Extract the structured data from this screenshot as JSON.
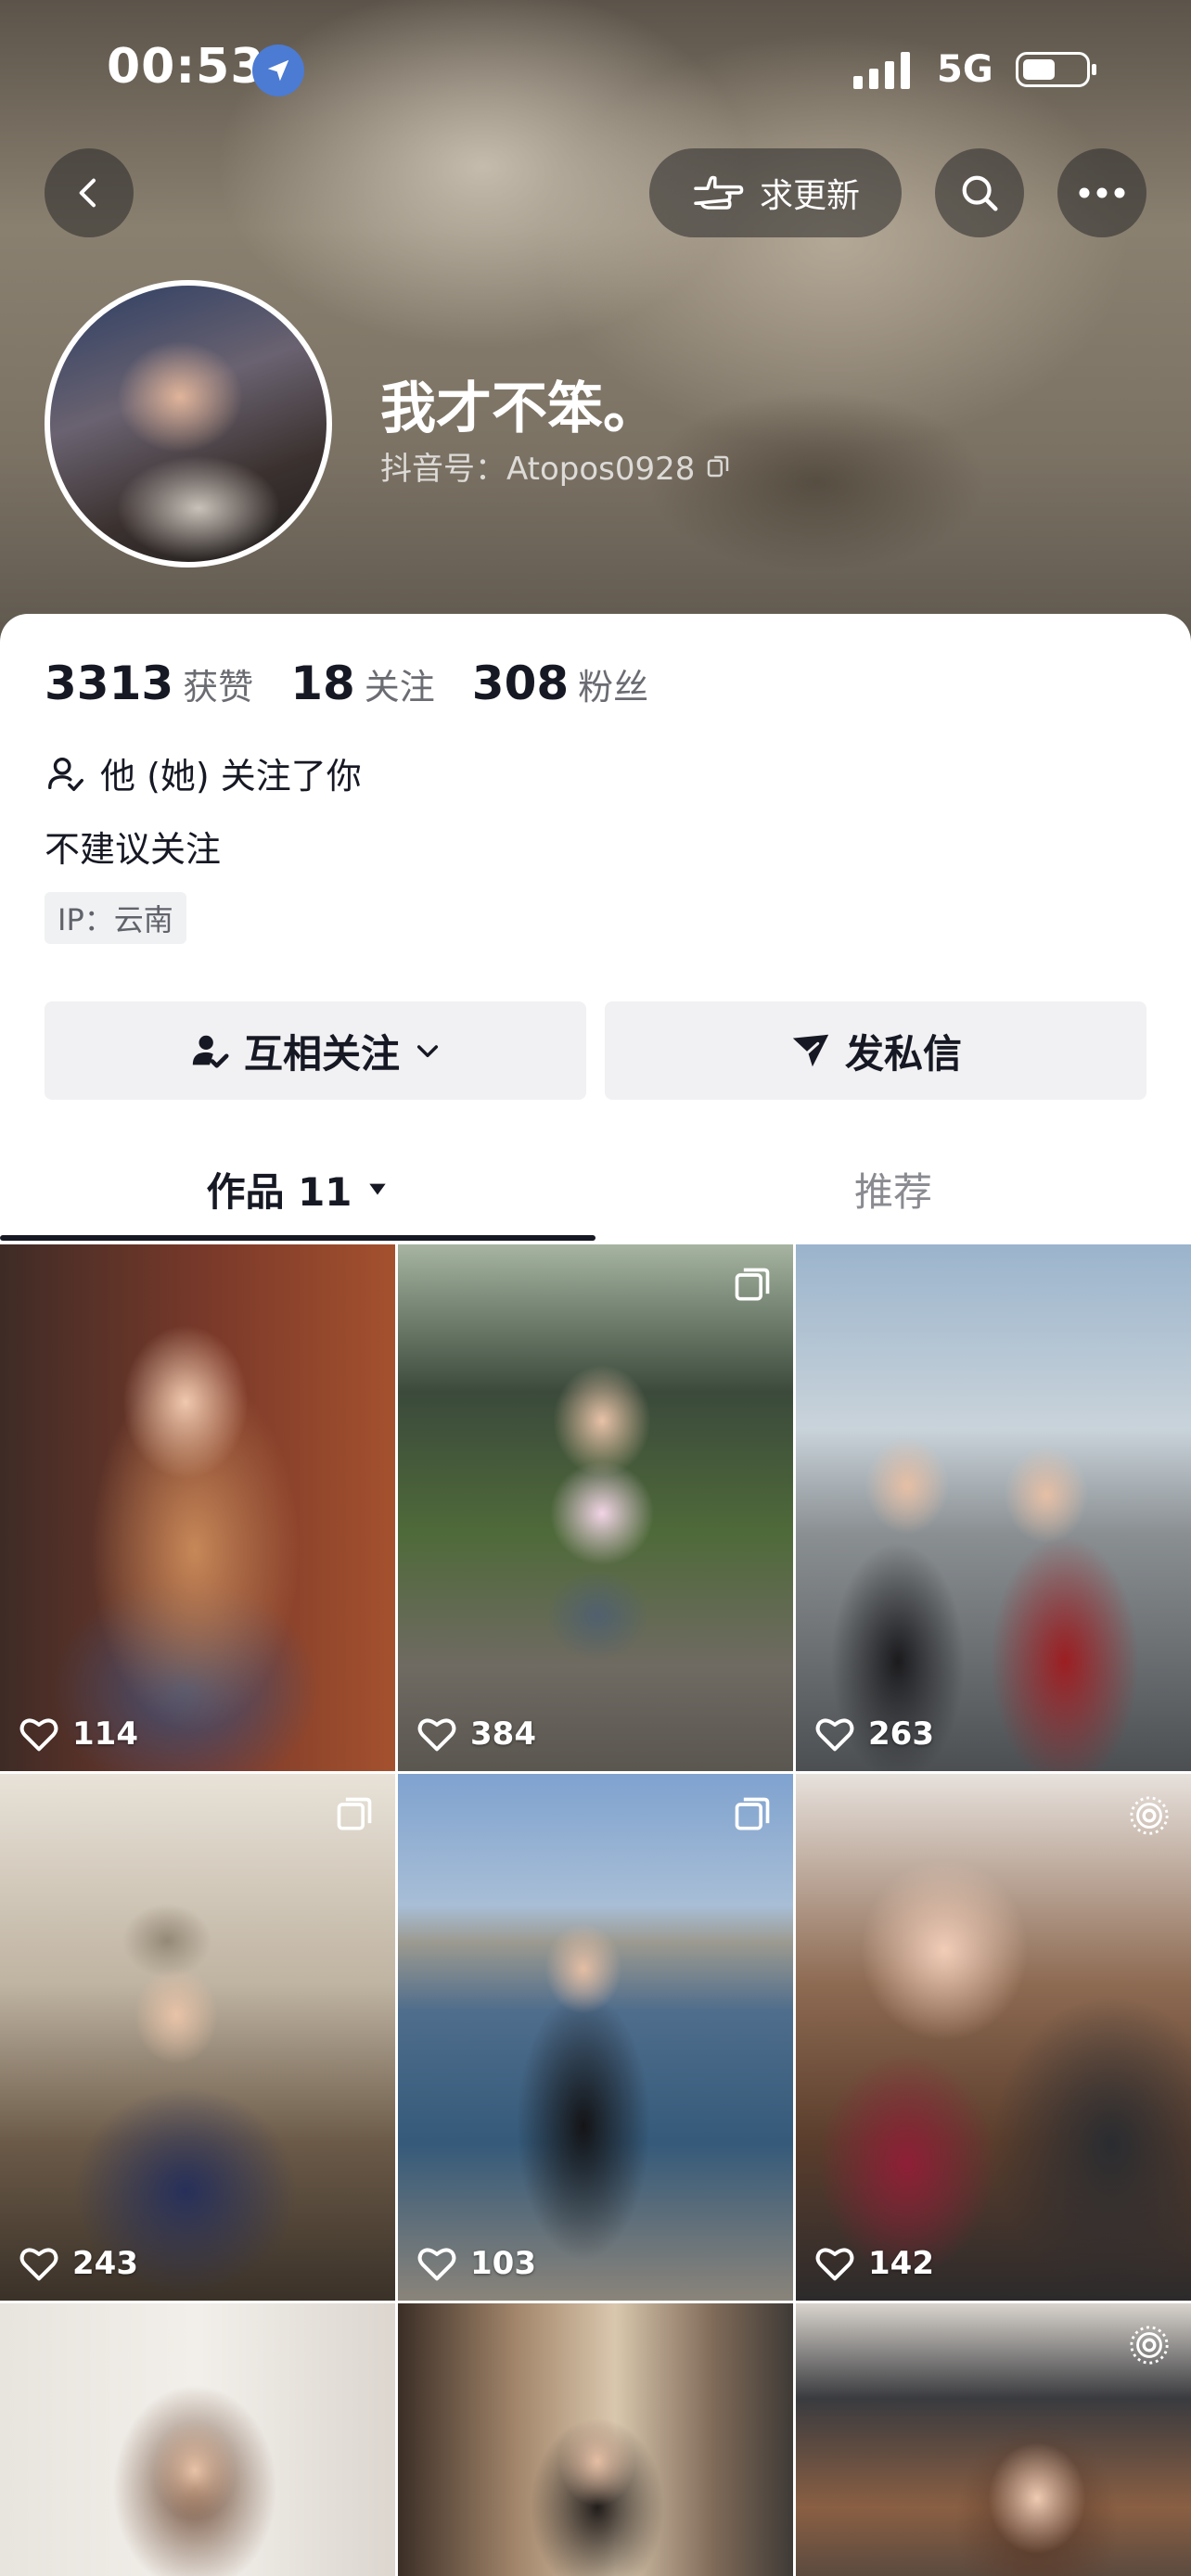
{
  "status_bar": {
    "time": "00:53",
    "network": "5G"
  },
  "header": {
    "update_request_label": "求更新"
  },
  "profile": {
    "nickname": "我才不笨。",
    "douyin_id": "抖音号：Atopos0928",
    "stats": [
      {
        "num": "3313",
        "label": "获赞"
      },
      {
        "num": "18",
        "label": "关注"
      },
      {
        "num": "308",
        "label": "粉丝"
      }
    ],
    "mutual_text": "他 (她) 关注了你",
    "bio": "不建议关注",
    "ip": "IP：云南"
  },
  "actions": {
    "follow_label": "互相关注",
    "message_label": "发私信"
  },
  "tabs": {
    "works_label": "作品 11",
    "recommend_label": "推荐"
  },
  "posts": [
    {
      "likes": "114",
      "corner": ""
    },
    {
      "likes": "384",
      "corner": "multi-image-icon"
    },
    {
      "likes": "263",
      "corner": ""
    },
    {
      "likes": "243",
      "corner": "multi-image-icon"
    },
    {
      "likes": "103",
      "corner": "multi-image-icon"
    },
    {
      "likes": "142",
      "corner": "live-photo-icon"
    },
    {
      "likes": "",
      "corner": ""
    },
    {
      "likes": "",
      "corner": ""
    },
    {
      "likes": "",
      "corner": "live-photo-icon"
    }
  ],
  "colors": {
    "text_primary": "#161823",
    "text_secondary": "#6b6c72",
    "button_bg": "#f1f1f3"
  }
}
